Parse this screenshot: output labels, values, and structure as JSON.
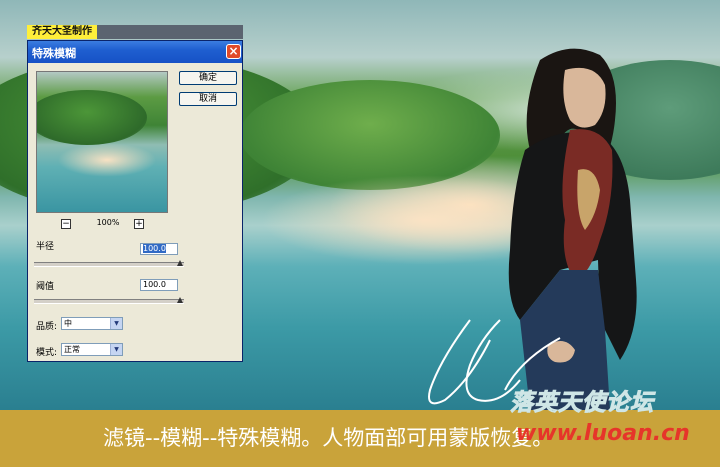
{
  "author_tag": "齐天大圣制作",
  "dialog": {
    "title": "特殊模糊",
    "close_glyph": "×",
    "ok_label": "确定",
    "cancel_label": "取消",
    "zoom_out_glyph": "−",
    "zoom_in_glyph": "+",
    "zoom_level": "100%",
    "radius_label": "半径",
    "radius_value": "100.0",
    "threshold_label": "阈值",
    "threshold_value": "100.0",
    "quality_label": "品质:",
    "quality_value": "中",
    "mode_label": "模式:",
    "mode_value": "正常",
    "dropdown_glyph": "▼"
  },
  "caption": {
    "text": "滤镜--模糊--特殊模糊。人物面部可用蒙版恢复。",
    "watermark": "落英天使论坛",
    "url": "www.luoan.cn"
  },
  "colors": {
    "caption_bar": "#c9a33a",
    "author_tag": "#ffef3a",
    "titlebar": "#1f5fd0",
    "url_text": "#e6352a"
  },
  "icons": [
    "close-icon",
    "zoom-out-icon",
    "zoom-in-icon",
    "chevron-down-icon"
  ]
}
